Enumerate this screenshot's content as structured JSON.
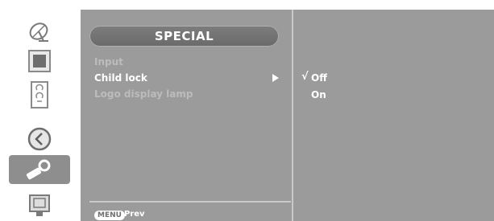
{
  "sidebar": {
    "icons": [
      {
        "name": "satellite-dish-icon",
        "active": false
      },
      {
        "name": "picture-icon",
        "active": false
      },
      {
        "name": "speaker-icon",
        "active": false
      },
      {
        "name": "clock-icon",
        "active": false
      },
      {
        "name": "special-tools-icon",
        "active": true
      },
      {
        "name": "screen-icon",
        "active": false
      }
    ]
  },
  "menu": {
    "title": "SPECIAL",
    "items": [
      {
        "label": "Input",
        "state": "dimmed"
      },
      {
        "label": "Child lock",
        "state": "selected"
      },
      {
        "label": "Logo display lamp",
        "state": "dimmed"
      }
    ],
    "footer": {
      "key_label": "MENU",
      "action_label": "Prev"
    }
  },
  "submenu": {
    "checkmark": "√",
    "options": [
      {
        "label": "Off",
        "checked": true
      },
      {
        "label": "On",
        "checked": false
      }
    ]
  },
  "colors": {
    "panel_bg": "#9b9b9b",
    "title_bg": "#747474",
    "text_selected": "#ffffff",
    "text_dimmed": "#bcbcbc",
    "active_icon_bg": "#8e8e8e"
  }
}
